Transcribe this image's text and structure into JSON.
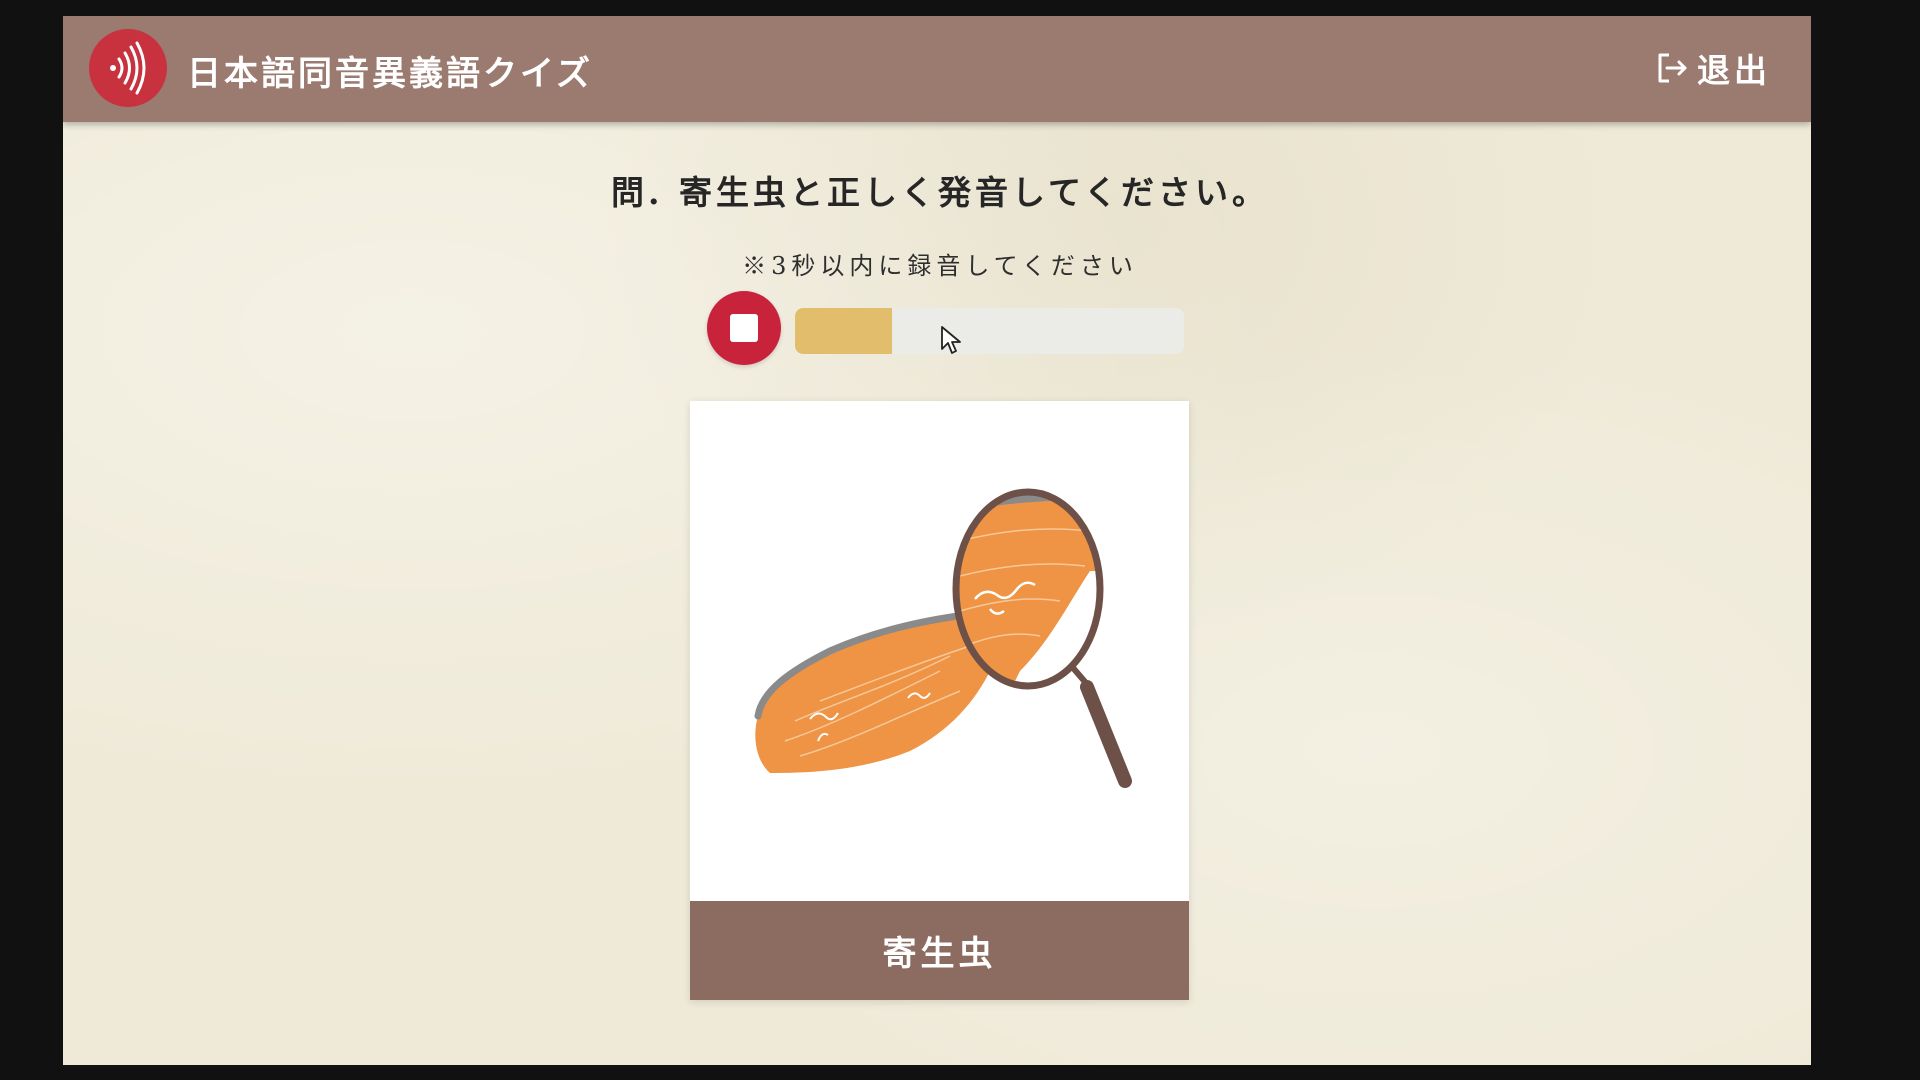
{
  "header": {
    "title": "日本語同音異義語クイズ",
    "logo_icon": "sound-wave-icon",
    "exit_label": "退出",
    "exit_icon": "logout-icon"
  },
  "question": {
    "prompt": "問. 寄生虫と正しく発音してください。",
    "note": "※3秒以内に録音してください"
  },
  "recorder": {
    "stop_icon": "stop-icon",
    "progress_fraction": 0.25
  },
  "card": {
    "image_icon": "salmon-magnifier-illustration",
    "label": "寄生虫"
  },
  "colors": {
    "header": "#9b7a70",
    "accent_red": "#c8323f",
    "progress": "#e2bd6c",
    "card_label": "#8c6b60",
    "paper": "#efead8"
  }
}
